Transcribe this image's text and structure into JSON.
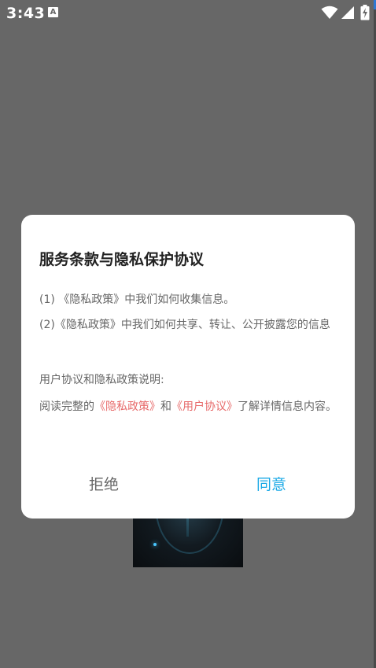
{
  "status_bar": {
    "time": "3:43",
    "notification_icon": "A",
    "icons": [
      "wifi-icon",
      "signal-icon",
      "battery-icon"
    ]
  },
  "dialog": {
    "title": "服务条款与隐私保护协议",
    "item_1": "(1) 《隐私政策》中我们如何收集信息。",
    "item_2": "(2)《隐私政策》中我们如何共享、转让、公开披露您的信息",
    "section_heading": "用户协议和隐私政策说明:",
    "read_prefix": "阅读完整的",
    "privacy_link": "《隐私政策》",
    "and": "和",
    "user_agreement_link": "《用户协议》",
    "read_suffix": "了解详情信息内容。",
    "reject_label": "拒绝",
    "agree_label": "同意"
  },
  "colors": {
    "overlay": "#676767",
    "link": "#e76a6a",
    "accent": "#18a8e6"
  }
}
